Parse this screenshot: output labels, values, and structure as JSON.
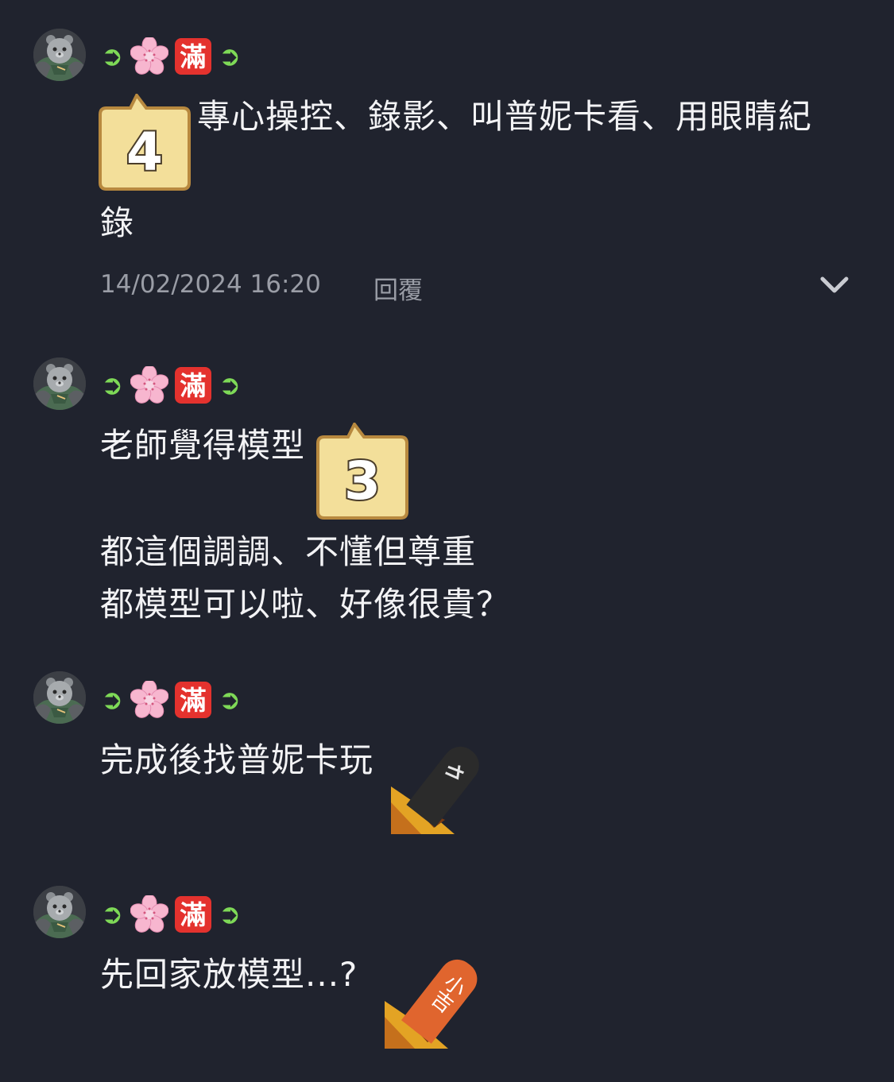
{
  "comments": [
    {
      "author": {
        "avatar_icon": "bear-avatar-icon",
        "prefix_arrow": "➲",
        "flower_icon": "cherry-blossom-icon",
        "badge": "滿",
        "suffix_arrow": "➲"
      },
      "sticker": {
        "icon": "speech-number-sticker-icon",
        "number": "4"
      },
      "lines": [
        "專心操控、錄影、叫普妮卡看、用眼睛紀",
        "錄"
      ],
      "timestamp": "14/02/2024 16:20",
      "reply_label": "回覆"
    },
    {
      "author": {
        "avatar_icon": "bear-avatar-icon",
        "prefix_arrow": "➲",
        "flower_icon": "cherry-blossom-icon",
        "badge": "滿",
        "suffix_arrow": "➲"
      },
      "lines": [
        "老師覺得模型",
        "都這個調調、不懂但尊重",
        "都模型可以啦、好像很貴？"
      ],
      "sticker": {
        "icon": "speech-number-sticker-icon",
        "number": "3"
      }
    },
    {
      "author": {
        "avatar_icon": "bear-avatar-icon",
        "prefix_arrow": "➲",
        "flower_icon": "cherry-blossom-icon",
        "badge": "滿",
        "suffix_arrow": "➲"
      },
      "lines": [
        "完成後找普妮卡玩"
      ],
      "sticker": {
        "icon": "black-fortune-stick-icon"
      }
    },
    {
      "author": {
        "avatar_icon": "bear-avatar-icon",
        "prefix_arrow": "➲",
        "flower_icon": "cherry-blossom-icon",
        "badge": "滿",
        "suffix_arrow": "➲"
      },
      "lines": [
        "先回家放模型...?"
      ],
      "sticker": {
        "icon": "orange-fortune-stick-icon",
        "text": "小吉"
      }
    }
  ],
  "colors": {
    "background": "#20232e",
    "text": "#f3f3f5",
    "meta": "#9a9da6",
    "arrow": "#7ed957",
    "badge": "#e4322e",
    "sticker_fill": "#f3df9a",
    "sticker_border": "#b8893f"
  }
}
